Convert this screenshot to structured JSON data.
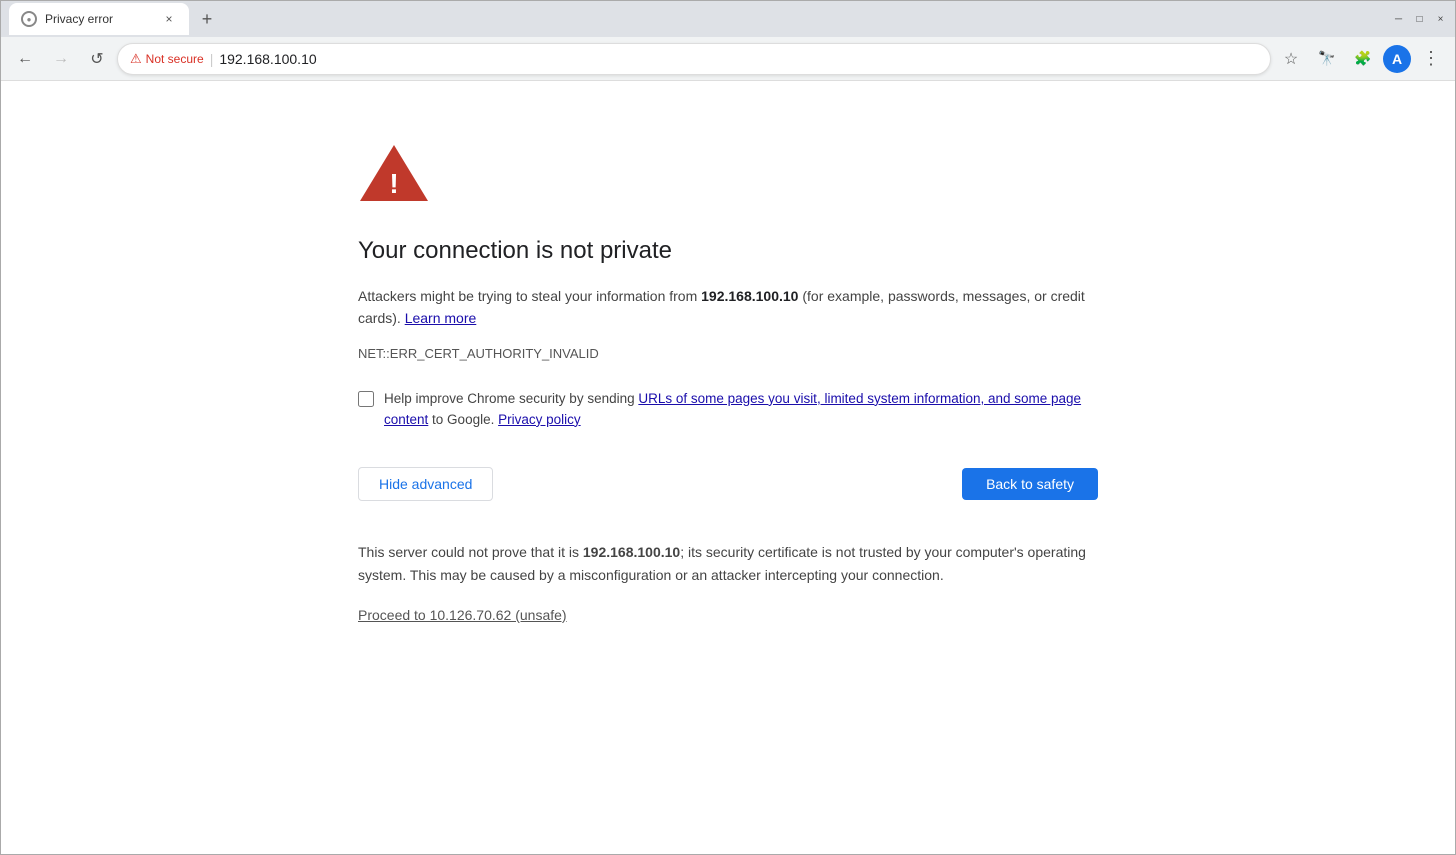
{
  "browser": {
    "tab": {
      "favicon": "●",
      "title": "Privacy error",
      "close": "×"
    },
    "new_tab_icon": "+",
    "window_controls": {
      "minimize": "─",
      "maximize": "□",
      "close": "×"
    }
  },
  "nav": {
    "back_icon": "←",
    "forward_icon": "→",
    "reload_icon": "↺",
    "security_label": "Not secure",
    "address": "192.168.100.10",
    "star_icon": "☆",
    "extensions_icon": "👁",
    "puzzle_icon": "🧩",
    "avatar_label": "A",
    "menu_icon": "⋮"
  },
  "page": {
    "heading": "Your connection is not private",
    "description_prefix": "Attackers might be trying to steal your information from ",
    "domain": "192.168.100.10",
    "description_suffix": " (for example, passwords, messages, or credit cards).",
    "learn_more": "Learn more",
    "error_code": "NET::ERR_CERT_AUTHORITY_INVALID",
    "checkbox_prefix": "Help improve Chrome security by sending ",
    "checkbox_link": "URLs of some pages you visit, limited system information, and some page content",
    "checkbox_suffix": " to Google.",
    "privacy_policy": "Privacy policy",
    "btn_hide_advanced": "Hide advanced",
    "btn_back_to_safety": "Back to safety",
    "advanced_prefix": "This server could not prove that it is ",
    "advanced_domain": "192.168.100.10",
    "advanced_suffix": "; its security certificate is not trusted by your computer's operating system. This may be caused by a misconfiguration or an attacker intercepting your connection.",
    "proceed_link": "Proceed to 10.126.70.62 (unsafe)"
  }
}
